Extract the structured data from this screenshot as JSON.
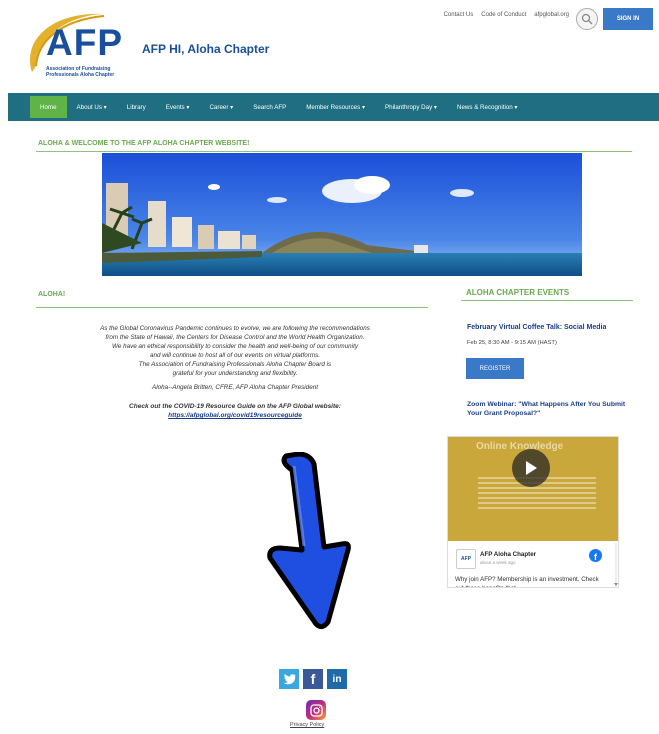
{
  "header": {
    "logo": {
      "letters": "AFP",
      "subtitle": "Association of Fundraising Professionals Aloha Chapter"
    },
    "site_title": "AFP HI, Aloha Chapter",
    "top_links": [
      "Contact Us",
      "Code of Conduct",
      "afpglobal.org"
    ],
    "signin_label": "SIGN IN",
    "search_icon": "search-icon"
  },
  "nav": {
    "items": [
      "Home",
      "About Us ▾",
      "Library",
      "Events ▾",
      "Career ▾",
      "Search AFP",
      "Member Resources ▾",
      "Philanthropy Day ▾",
      "News & Recognition ▾"
    ],
    "active": "Home"
  },
  "welcome": {
    "heading": "ALOHA & WELCOME TO THE AFP ALOHA CHAPTER WEBSITE!"
  },
  "aloha": {
    "heading": "ALOHA!",
    "body_lines": [
      "As the Global Coronavirus Pandemic continues to evolve, we are following the recommendations",
      "from the State of Hawaii, the Centers for Disease Control and the World Health Organization.",
      "We have an ethical responsibility to consider the health and well-being of our community",
      "and will continue to host all of our events on virtual platforms.",
      "The Association of Fundraising Professionals Aloha Chapter Board is",
      "grateful for your understanding and flexibility."
    ],
    "signature": "Aloha--Angela Britten, CFRE, AFP Aloha Chapter President",
    "covid_text": "Check out the COVID-19 Resource Guide on the AFP Global website:",
    "covid_link": "https://afpglobal.org/covid19resourceguide"
  },
  "events": {
    "heading": "ALOHA CHAPTER EVENTS",
    "event1_title": "February Virtual Coffee Talk: Social Media",
    "event1_date": "Feb 25, 8:30 AM - 9:15 AM (HAST)",
    "register_label": "REGISTER",
    "event2_title": "Zoom Webinar: \"What Happens After You Submit Your Grant Proposal?\""
  },
  "facebook": {
    "cover_title": "Online Knowledge",
    "page_name": "AFP Aloha Chapter",
    "post_time": "about a week ago",
    "avatar_text": "AFP",
    "post_text": "Why join AFP? Membership is an investment. Check out these benefits that..."
  },
  "footer": {
    "social": [
      "twitter-icon",
      "facebook-icon",
      "linkedin-icon"
    ],
    "privacy_label": "Privacy Policy"
  },
  "colors": {
    "nav_bg": "#1f6e82",
    "active_green": "#5fb347",
    "heading_green": "#6aa84f",
    "brand_blue": "#1a4f9c",
    "button_blue": "#3a78c8",
    "arrow_blue": "#1e4fe0"
  }
}
